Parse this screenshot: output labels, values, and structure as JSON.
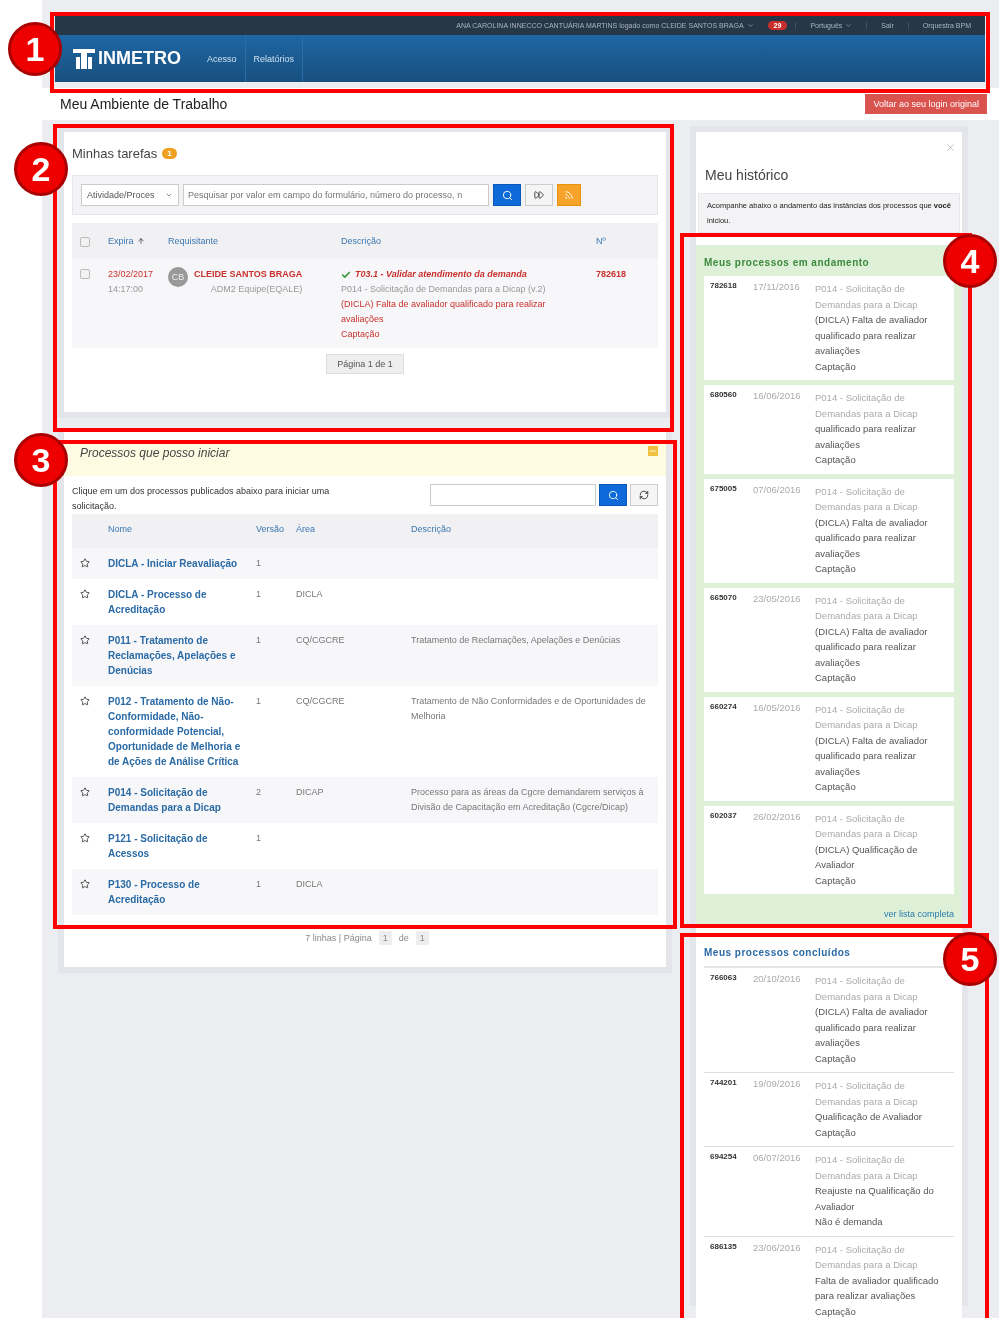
{
  "header": {
    "logo": "INMETRO",
    "user_menu": "ANA CAROLINA INNECCO CANTUÁRIA MARTINS logado como CLEIDE SANTOS BRAGA",
    "notifications": "29",
    "language": "Português",
    "logout": "Sair",
    "app": "Orquestra BPM",
    "nav": [
      "Acesso",
      "Relatórios"
    ]
  },
  "page_title": "Meu Ambiente de Trabalho",
  "back_button": "Voltar ao seu login original",
  "tasks": {
    "title": "Minhas tarefas",
    "count": "1",
    "select_all_checked": false,
    "filter": "Atividade/Proces",
    "search_placeholder": "Pesquisar por valor em campo do formulário, número do processo, n",
    "columns": [
      "Expira",
      "Requisitante",
      "Descrição",
      "Nº"
    ],
    "rows": [
      {
        "checked": false,
        "date": "23/02/2017",
        "time": "14:17:00",
        "initials": "CB",
        "requester": "CLEIDE SANTOS BRAGA",
        "team": "ADM2 Equipe(EQALE)",
        "task": "T03.1 - Validar atendimento da demanda",
        "process": "P014 - Solicitação de Demandas para a Dicap (v.2)",
        "description": "(DICLA) Falta de avaliador qualificado para realizar avaliações",
        "stage": "Captação",
        "number": "782618"
      }
    ],
    "pagination": "Página 1 de 1"
  },
  "startable": {
    "title": "Processos que posso iniciar",
    "hint": "Clique em um dos processos publicados abaixo para iniciar uma solicitação.",
    "columns": [
      "Nome",
      "Versão",
      "Área",
      "Descrição"
    ],
    "rows": [
      {
        "name": "DICLA - Iniciar Reavaliação",
        "version": "1",
        "area": "",
        "description": ""
      },
      {
        "name": "DICLA - Processo de Acreditação",
        "version": "1",
        "area": "DICLA",
        "description": ""
      },
      {
        "name": "P011 - Tratamento de Reclamações, Apelações e Denúcias",
        "version": "1",
        "area": "CQ/CGCRE",
        "description": "Tratamento de Reclamações, Apelações e Denúcias"
      },
      {
        "name": "P012 - Tratamento de Não-Conformidade, Não-conformidade Potencial, Oportunidade de Melhoria e de Ações de Análise Crítica",
        "version": "1",
        "area": "CQ/CGCRE",
        "description": "Tratamento de Não Conformidades e de Oportunidades de Melhoria"
      },
      {
        "name": "P014 - Solicitação de Demandas para a Dicap",
        "version": "2",
        "area": "DICAP",
        "description": "Processo para as áreas da Cgcre demandarem serviços à Divisão de Capacitação em Acreditação (Cgcre/Dicap)"
      },
      {
        "name": "P121 - Solicitação de Acessos",
        "version": "1",
        "area": "",
        "description": ""
      },
      {
        "name": "P130 - Processo de Acreditação",
        "version": "1",
        "area": "DICLA",
        "description": ""
      }
    ],
    "footer": [
      "7 linhas | Página",
      "1",
      "de",
      "1"
    ]
  },
  "history": {
    "title": "Meu histórico",
    "intro": "Acompanhe abaixo o andamento das instâncias dos processos que **você** iniciou.",
    "in_progress": {
      "title": "Meus processos em andamento",
      "link": "ver lista completa",
      "items": [
        {
          "number": "782618",
          "date": "17/11/2016",
          "process": "P014 - Solicitação de Demandas para a Dicap",
          "description": "(DICLA) Falta de avaliador qualificado para realizar avaliações",
          "stage": "Captação"
        },
        {
          "number": "680560",
          "date": "16/06/2016",
          "process": "P014 - Solicitação de Demandas para a Dicap",
          "description": "qualificado para realizar avaliações",
          "stage": "Captação"
        },
        {
          "number": "675005",
          "date": "07/06/2016",
          "process": "P014 - Solicitação de Demandas para a Dicap",
          "description": "(DICLA) Falta de avaliador qualificado para realizar avaliações",
          "stage": "Captação"
        },
        {
          "number": "665070",
          "date": "23/05/2016",
          "process": "P014 - Solicitação de Demandas para a Dicap",
          "description": "(DICLA) Falta de avaliador qualificado para realizar avaliações",
          "stage": "Captação"
        },
        {
          "number": "660274",
          "date": "16/05/2016",
          "process": "P014 - Solicitação de Demandas para a Dicap",
          "description": "(DICLA) Falta de avaliador qualificado para realizar avaliações",
          "stage": "Captação"
        },
        {
          "number": "602037",
          "date": "26/02/2016",
          "process": "P014 - Solicitação de Demandas para a Dicap",
          "description": "(DICLA) Qualificação de Avaliador",
          "stage": "Captação"
        }
      ]
    },
    "completed": {
      "title": "Meus processos concluídos",
      "items": [
        {
          "number": "766063",
          "date": "20/10/2016",
          "process": "P014 - Solicitação de Demandas para a Dicap",
          "description": "(DICLA) Falta de avaliador qualificado para realizar avaliações",
          "stage": "Captação"
        },
        {
          "number": "744201",
          "date": "19/09/2016",
          "process": "P014 - Solicitação de Demandas para a Dicap",
          "description": "Qualificação de Avaliador",
          "stage": "Captação"
        },
        {
          "number": "694254",
          "date": "06/07/2016",
          "process": "P014 - Solicitação de Demandas para a Dicap",
          "description": "Reajuste na Qualificação do Avaliador",
          "stage": "Não é demanda"
        },
        {
          "number": "686135",
          "date": "23/06/2016",
          "process": "P014 - Solicitação de Demandas para a Dicap",
          "description": "Falta de avaliador qualificado para realizar avaliações",
          "stage": "Captação"
        }
      ]
    }
  },
  "annotations": [
    "1",
    "2",
    "3",
    "4",
    "5"
  ]
}
